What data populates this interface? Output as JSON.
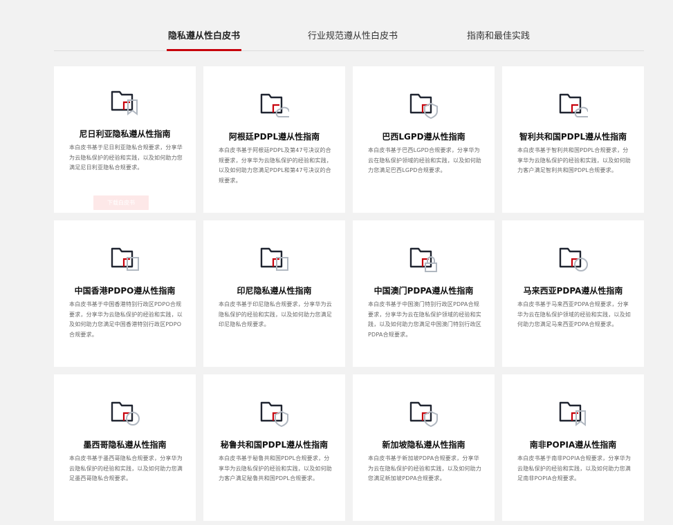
{
  "tabs": [
    {
      "label": "隐私遵从性白皮书",
      "active": true
    },
    {
      "label": "行业规范遵从性白皮书",
      "active": false
    },
    {
      "label": "指南和最佳实践",
      "active": false
    }
  ],
  "cards": [
    {
      "title": "尼日利亚隐私遵从性指南",
      "desc": "本白皮书基于尼日利亚隐私合规要求，分享华为云隐私保护的经验和实践，以及如何助力您满足尼日利亚隐私合规要求。",
      "icon": "folder-bookmark-icon",
      "hovered": true,
      "button": "下载白皮书"
    },
    {
      "title": "阿根廷PDPL遵从性指南",
      "desc": "本白皮书基于阿根廷PDPL及第47号决议的合规要求，分享华为云隐私保护的经验和实践，以及如何助力您满足PDPL和第47号决议的合规要求。",
      "icon": "folder-cloud-icon"
    },
    {
      "title": "巴西LGPD遵从性指南",
      "desc": "本白皮书基于巴西LGPD合规要求，分享华为云在隐私保护领域的经验和实践，以及如何助力您满足巴西LGPD合规要求。",
      "icon": "folder-shield-icon"
    },
    {
      "title": "智利共和国PDPL遵从性指南",
      "desc": "本白皮书基于智利共和国PDPL合规要求，分享华为云隐私保护的经验和实践，以及如何助力客户满足智利共和国PDPL合规要求。",
      "icon": "folder-cloud-icon"
    },
    {
      "title": "中国香港PDPO遵从性指南",
      "desc": "本白皮书基于中国香港特别行政区PDPO合规要求，分享华为云隐私保护的经验和实践，以及如何助力您满足中国香港特别行政区PDPO合规要求。",
      "icon": "folder-square-icon"
    },
    {
      "title": "印尼隐私遵从性指南",
      "desc": "本白皮书基于印尼隐私合规要求，分享华为云隐私保护的经验和实践，以及如何助力您满足印尼隐私合规要求。",
      "icon": "folder-square-icon"
    },
    {
      "title": "中国澳门PDPA遵从性指南",
      "desc": "本白皮书基于中国澳门特别行政区PDPA合规要求，分享华为云在隐私保护领域的经验和实践，以及如何助力您满足中国澳门特别行政区PDPA合规要求。",
      "icon": "folder-lock-icon"
    },
    {
      "title": "马来西亚PDPA遵从性指南",
      "desc": "本白皮书基于马来西亚PDPA合规要求，分享华为云在隐私保护领域的经验和实践，以及如何助力您满足马来西亚PDPA合规要求。",
      "icon": "folder-circle-icon"
    },
    {
      "title": "墨西哥隐私遵从性指南",
      "desc": "本白皮书基于墨西哥隐私合规要求，分享华为云隐私保护的经验和实践，以及如何助力您满足墨西哥隐私合规要求。",
      "icon": "folder-circle-icon"
    },
    {
      "title": "秘鲁共和国PDPL遵从性指南",
      "desc": "本白皮书基于秘鲁共和国PDPL合规要求，分享华为云隐私保护的经验和实践，以及如何助力客户满足秘鲁共和国PDPL合规要求。",
      "icon": "folder-shield-icon"
    },
    {
      "title": "新加坡隐私遵从性指南",
      "desc": "本白皮书基于新加坡PDPA合规要求，分享华为云在隐私保护的经验和实践，以及如何助力您满足新加坡PDPA合规要求。",
      "icon": "folder-shield-icon"
    },
    {
      "title": "南非POPIA遵从性指南",
      "desc": "本白皮书基于南非POPIA合规要求，分享华为云隐私保护的经验和实践，以及如何助力您满足南非POPIA合规要求。",
      "icon": "folder-bookmark-icon"
    }
  ],
  "colors": {
    "accent": "#c7000b",
    "dark": "#1f2430",
    "gray": "#b0b7c0"
  }
}
